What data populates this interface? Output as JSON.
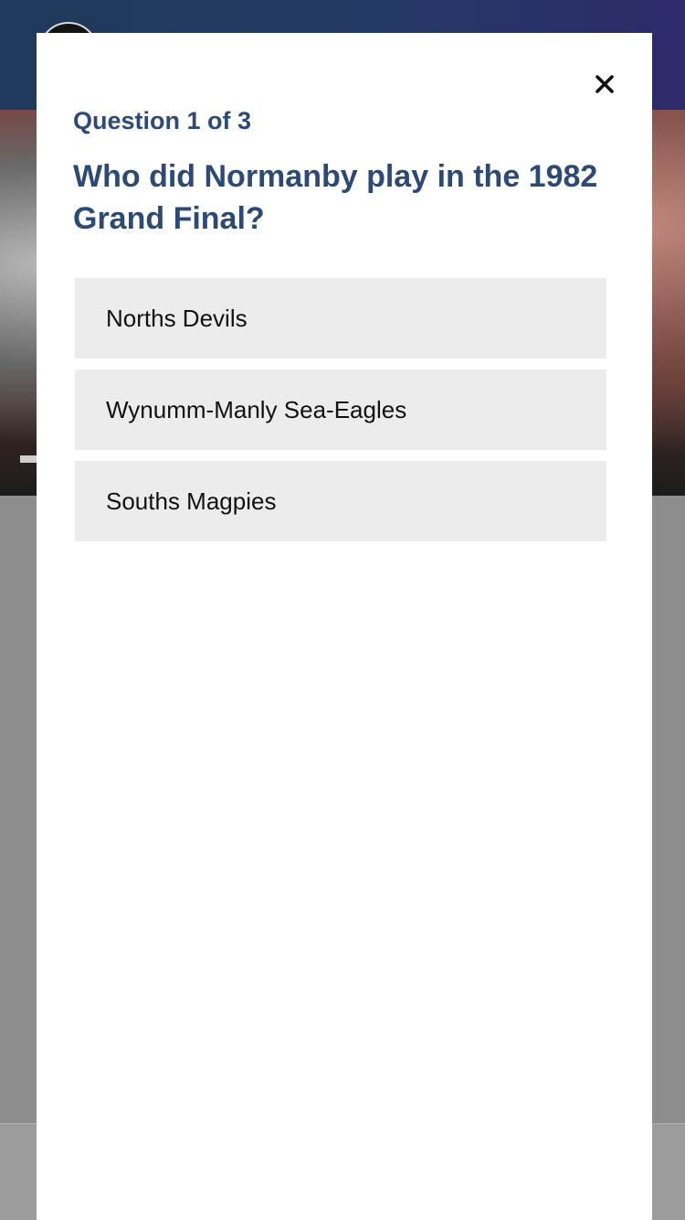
{
  "quiz": {
    "counter_label": "Question 1 of 3",
    "question_text": "Who did Normanby play in the 1982 Grand Final?",
    "answers": [
      {
        "label": "Norths Devils"
      },
      {
        "label": "Wynumm-Manly Sea-Eagles"
      },
      {
        "label": "Souths Magpies"
      }
    ],
    "close_icon": "close-icon"
  },
  "colors": {
    "heading": "#2c4a75",
    "answer_background": "#edecec",
    "answer_text": "#111111",
    "modal_background": "#ffffff"
  }
}
